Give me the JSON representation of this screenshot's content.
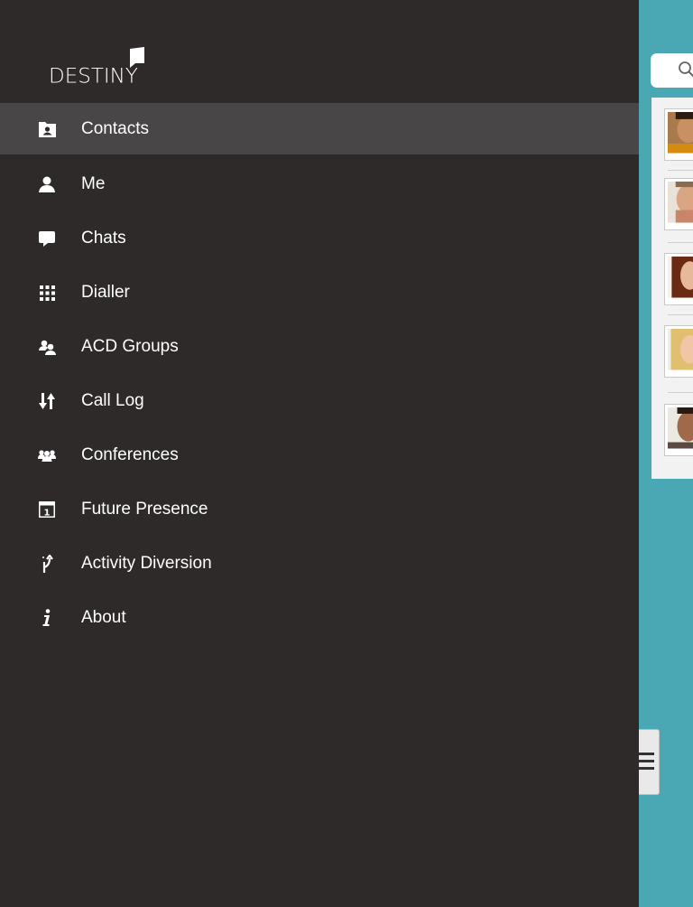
{
  "app": {
    "logo_text": "DESTINY"
  },
  "menu": {
    "items": [
      {
        "label": "Contacts",
        "icon": "contacts-icon",
        "active": true
      },
      {
        "label": "Me",
        "icon": "person-icon",
        "active": false
      },
      {
        "label": "Chats",
        "icon": "chat-bubble-icon",
        "active": false
      },
      {
        "label": "Dialler",
        "icon": "dialpad-icon",
        "active": false
      },
      {
        "label": "ACD Groups",
        "icon": "acd-groups-icon",
        "active": false
      },
      {
        "label": "Call Log",
        "icon": "call-log-icon",
        "active": false
      },
      {
        "label": "Conferences",
        "icon": "conferences-icon",
        "active": false
      },
      {
        "label": "Future Presence",
        "icon": "calendar-icon",
        "active": false
      },
      {
        "label": "Activity Diversion",
        "icon": "diversion-icon",
        "active": false
      },
      {
        "label": "About",
        "icon": "info-icon",
        "active": false
      }
    ]
  },
  "colors": {
    "drawer_bg": "#2e2a2a",
    "active_bg": "#484646",
    "panel_bg": "#4aa8b4",
    "text": "#ffffff"
  }
}
